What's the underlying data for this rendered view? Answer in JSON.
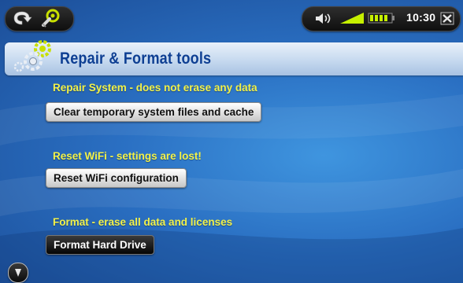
{
  "status": {
    "time": "10:30"
  },
  "page": {
    "title": "Repair & Format tools"
  },
  "sections": [
    {
      "heading": "Repair System - does not erase any data",
      "button": "Clear temporary system files and cache"
    },
    {
      "heading": "Reset WiFi - settings are lost!",
      "button": "Reset WiFi configuration"
    },
    {
      "heading": "Format - erase all data and licenses",
      "button": "Format Hard Drive"
    }
  ],
  "icons": {
    "back": "back-arrow-icon",
    "tools": "tools-icon",
    "volume": "volume-icon",
    "wifi": "wifi-signal-icon",
    "battery": "battery-icon",
    "close": "close-icon",
    "gears": "gears-icon",
    "scroll_down": "scroll-down-icon"
  },
  "colors": {
    "heading": "#f2f24a",
    "title": "#0e3f93",
    "background": "#2a6fc2",
    "battery": "#c6f000"
  }
}
